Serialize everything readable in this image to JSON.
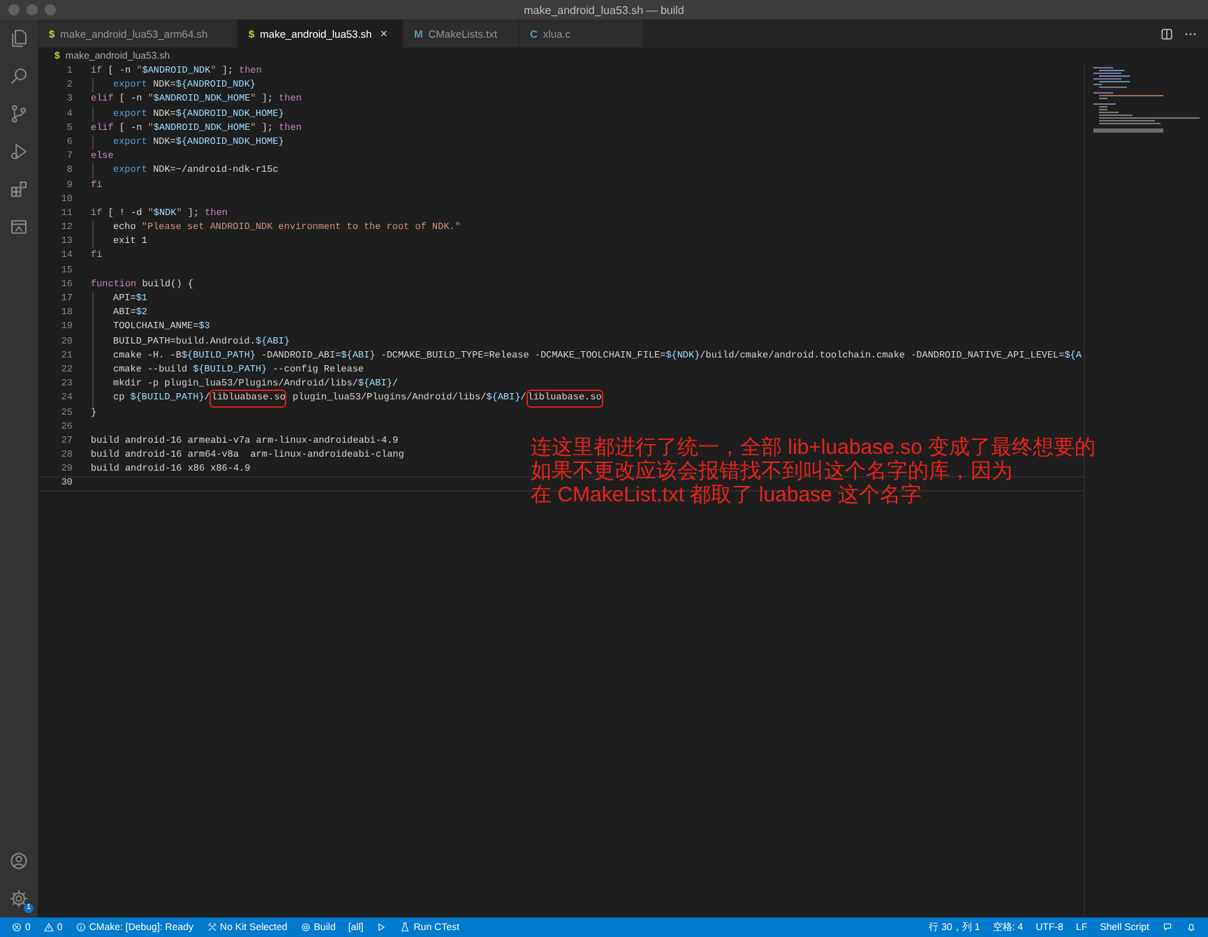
{
  "window": {
    "title": "make_android_lua53.sh — build"
  },
  "activity_bar": {
    "top": [
      {
        "kind": "files"
      },
      {
        "kind": "search"
      },
      {
        "kind": "source-control"
      },
      {
        "kind": "run"
      },
      {
        "kind": "extensions"
      },
      {
        "kind": "remote"
      }
    ],
    "bottom": [
      {
        "kind": "account"
      },
      {
        "kind": "settings",
        "badge": "1"
      }
    ]
  },
  "tabs": [
    {
      "icon": "$",
      "color": "#cbcb41",
      "label": "make_android_lua53_arm64.sh",
      "selected": false
    },
    {
      "icon": "$",
      "color": "#cbcb41",
      "label": "make_android_lua53.sh",
      "selected": true,
      "close": "×"
    },
    {
      "icon": "M",
      "color": "#519aba",
      "label": "CMakeLists.txt",
      "selected": false
    },
    {
      "icon": "C",
      "color": "#519aba",
      "label": "xlua.c",
      "selected": false
    }
  ],
  "breadcrumb": {
    "icon": "$",
    "label": "make_android_lua53.sh"
  },
  "code": [
    {
      "number": "1",
      "segments": [
        {
          "kind": "kw",
          "text": "if"
        },
        {
          "kind": "plain",
          "text": " [ -n "
        },
        {
          "kind": "str",
          "text": "\""
        },
        {
          "kind": "var",
          "text": "$ANDROID_NDK"
        },
        {
          "kind": "str",
          "text": "\""
        },
        {
          "kind": "plain",
          "text": " ]; "
        },
        {
          "kind": "kw",
          "text": "then"
        }
      ],
      "children": [
        {
          "number": "2",
          "segments": [
            {
              "kind": "builtin",
              "text": "export"
            },
            {
              "kind": "plain",
              "text": " NDK="
            },
            {
              "kind": "var",
              "text": "${ANDROID_NDK}"
            }
          ]
        }
      ]
    },
    {
      "number": "3",
      "segments": [
        {
          "kind": "kw",
          "text": "elif"
        },
        {
          "kind": "plain",
          "text": " [ -n "
        },
        {
          "kind": "str",
          "text": "\""
        },
        {
          "kind": "var",
          "text": "$ANDROID_NDK_HOME"
        },
        {
          "kind": "str",
          "text": "\""
        },
        {
          "kind": "plain",
          "text": " ]; "
        },
        {
          "kind": "kw",
          "text": "then"
        }
      ],
      "children": [
        {
          "number": "4",
          "segments": [
            {
              "kind": "builtin",
              "text": "export"
            },
            {
              "kind": "plain",
              "text": " NDK="
            },
            {
              "kind": "var",
              "text": "${ANDROID_NDK_HOME}"
            }
          ]
        }
      ]
    },
    {
      "number": "5",
      "segments": [
        {
          "kind": "kw",
          "text": "elif"
        },
        {
          "kind": "plain",
          "text": " [ -n "
        },
        {
          "kind": "str",
          "text": "\""
        },
        {
          "kind": "var",
          "text": "$ANDROID_NDK_HOME"
        },
        {
          "kind": "str",
          "text": "\""
        },
        {
          "kind": "plain",
          "text": " ]; "
        },
        {
          "kind": "kw",
          "text": "then"
        }
      ],
      "children": [
        {
          "number": "6",
          "segments": [
            {
              "kind": "builtin",
              "text": "export"
            },
            {
              "kind": "plain",
              "text": " NDK="
            },
            {
              "kind": "var",
              "text": "${ANDROID_NDK_HOME}"
            }
          ]
        }
      ]
    },
    {
      "number": "7",
      "segments": [
        {
          "kind": "kw",
          "text": "else"
        }
      ],
      "children": [
        {
          "number": "8",
          "segments": [
            {
              "kind": "builtin",
              "text": "export"
            },
            {
              "kind": "plain",
              "text": " NDK=~/android-ndk-r15c"
            }
          ]
        }
      ]
    },
    {
      "number": "9",
      "segments": [
        {
          "kind": "kw",
          "text": "fi"
        }
      ]
    },
    {
      "number": "10"
    },
    {
      "number": "11",
      "segments": [
        {
          "kind": "kw",
          "text": "if"
        },
        {
          "kind": "plain",
          "text": " [ ! -d "
        },
        {
          "kind": "str",
          "text": "\""
        },
        {
          "kind": "var",
          "text": "$NDK"
        },
        {
          "kind": "str",
          "text": "\""
        },
        {
          "kind": "plain",
          "text": " ]; "
        },
        {
          "kind": "kw",
          "text": "then"
        }
      ],
      "children": [
        {
          "number": "12",
          "segments": [
            {
              "kind": "plain",
              "text": "echo "
            },
            {
              "kind": "str",
              "text": "\"Please set ANDROID_NDK environment to the root of NDK.\""
            }
          ]
        },
        {
          "number": "13",
          "segments": [
            {
              "kind": "plain",
              "text": "exit 1"
            }
          ]
        }
      ]
    },
    {
      "number": "14",
      "segments": [
        {
          "kind": "kw",
          "text": "fi"
        }
      ]
    },
    {
      "number": "15"
    },
    {
      "number": "16",
      "segments": [
        {
          "kind": "kw",
          "text": "function"
        },
        {
          "kind": "plain",
          "text": " build() {"
        }
      ],
      "children": [
        {
          "number": "17",
          "segments": [
            {
              "kind": "plain",
              "text": "API="
            },
            {
              "kind": "var",
              "text": "$1"
            }
          ]
        },
        {
          "number": "18",
          "segments": [
            {
              "kind": "plain",
              "text": "ABI="
            },
            {
              "kind": "var",
              "text": "$2"
            }
          ]
        },
        {
          "number": "19",
          "segments": [
            {
              "kind": "plain",
              "text": "TOOLCHAIN_ANME="
            },
            {
              "kind": "var",
              "text": "$3"
            }
          ]
        },
        {
          "number": "20",
          "segments": [
            {
              "kind": "plain",
              "text": "BUILD_PATH=build.Android."
            },
            {
              "kind": "var",
              "text": "${ABI}"
            }
          ]
        },
        {
          "number": "21",
          "segments": [
            {
              "kind": "plain",
              "text": "cmake -H. -B"
            },
            {
              "kind": "var",
              "text": "${BUILD_PATH}"
            },
            {
              "kind": "plain",
              "text": " -DANDROID_ABI="
            },
            {
              "kind": "var",
              "text": "${ABI}"
            },
            {
              "kind": "plain",
              "text": " -DCMAKE_BUILD_TYPE=Release -DCMAKE_TOOLCHAIN_FILE="
            },
            {
              "kind": "var",
              "text": "${NDK}"
            },
            {
              "kind": "plain",
              "text": "/build/cmake/android.toolchain.cmake -DANDROID_NATIVE_API_LEVEL="
            },
            {
              "kind": "var",
              "text": "${A"
            }
          ]
        },
        {
          "number": "22",
          "segments": [
            {
              "kind": "plain",
              "text": "cmake --build "
            },
            {
              "kind": "var",
              "text": "${BUILD_PATH}"
            },
            {
              "kind": "plain",
              "text": " --config Release"
            }
          ]
        },
        {
          "number": "23",
          "segments": [
            {
              "kind": "plain",
              "text": "mkdir -p plugin_lua53/Plugins/Android/libs/"
            },
            {
              "kind": "var",
              "text": "${ABI}"
            },
            {
              "kind": "plain",
              "text": "/"
            }
          ]
        },
        {
          "number": "24",
          "segments": [
            {
              "kind": "plain",
              "text": "cp "
            },
            {
              "kind": "var",
              "text": "${BUILD_PATH}"
            },
            {
              "kind": "plain",
              "text": "/"
            },
            {
              "kind": "boxed",
              "text": "libluabase.so"
            },
            {
              "kind": "plain",
              "text": " plugin_lua53/Plugins/Android/libs/"
            },
            {
              "kind": "var",
              "text": "${ABI}"
            },
            {
              "kind": "plain",
              "text": "/"
            },
            {
              "kind": "boxed",
              "text": "libluabase.so"
            }
          ]
        }
      ]
    },
    {
      "number": "25",
      "segments": [
        {
          "kind": "plain",
          "text": "}"
        }
      ]
    },
    {
      "number": "26"
    },
    {
      "number": "27",
      "segments": [
        {
          "kind": "plain",
          "text": "build android-16 armeabi-v7a arm-linux-androideabi-4.9"
        }
      ]
    },
    {
      "number": "28",
      "segments": [
        {
          "kind": "plain",
          "text": "build android-16 arm64-v8a  arm-linux-androideabi-clang"
        }
      ]
    },
    {
      "number": "29",
      "segments": [
        {
          "kind": "plain",
          "text": "build android-16 x86 x86-4.9"
        }
      ]
    },
    {
      "number": "30",
      "current": true
    }
  ],
  "annotation": [
    "连这里都进行了统一，全部 lib+luabase.so 变成了最终想要的",
    "如果不更改应该会报错找不到叫这个名字的库，因为",
    "在 CMakeList.txt 都取了 luabase 这个名字"
  ],
  "status_bar": {
    "left": [
      {
        "kind": "errors",
        "text": "0"
      },
      {
        "kind": "warnings",
        "text": "0"
      },
      {
        "kind": "info",
        "text": "CMake: [Debug]: Ready"
      },
      {
        "kind": "kit",
        "text": "No Kit Selected"
      },
      {
        "kind": "gear",
        "text": "Build"
      },
      {
        "kind": "plain",
        "text": "[all]"
      },
      {
        "kind": "play"
      },
      {
        "kind": "flask",
        "text": "Run CTest"
      }
    ],
    "right": [
      {
        "kind": "plain",
        "text": "行 30，列 1"
      },
      {
        "kind": "plain",
        "text": "空格: 4"
      },
      {
        "kind": "plain",
        "text": "UTF-8"
      },
      {
        "kind": "plain",
        "text": "LF"
      },
      {
        "kind": "plain",
        "text": "Shell Script"
      },
      {
        "kind": "feedback"
      },
      {
        "kind": "bell"
      }
    ]
  }
}
